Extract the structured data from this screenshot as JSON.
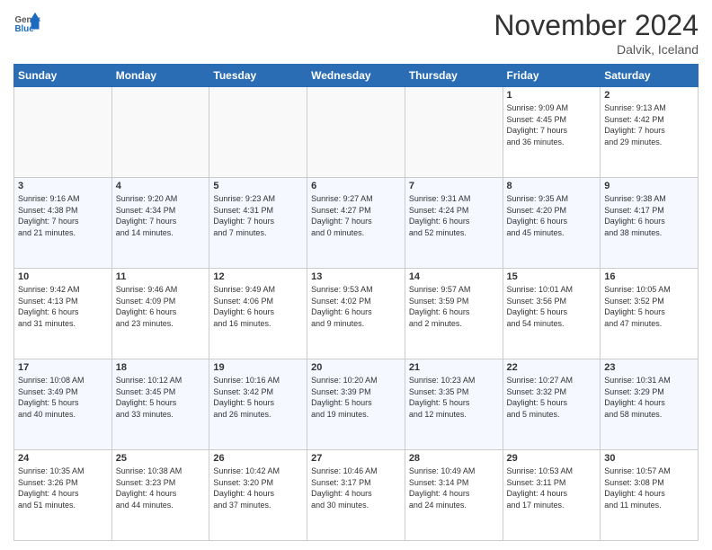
{
  "header": {
    "logo_general": "General",
    "logo_blue": "Blue",
    "month_title": "November 2024",
    "subtitle": "Dalvik, Iceland"
  },
  "days_of_week": [
    "Sunday",
    "Monday",
    "Tuesday",
    "Wednesday",
    "Thursday",
    "Friday",
    "Saturday"
  ],
  "weeks": [
    [
      {
        "day": "",
        "info": ""
      },
      {
        "day": "",
        "info": ""
      },
      {
        "day": "",
        "info": ""
      },
      {
        "day": "",
        "info": ""
      },
      {
        "day": "",
        "info": ""
      },
      {
        "day": "1",
        "info": "Sunrise: 9:09 AM\nSunset: 4:45 PM\nDaylight: 7 hours\nand 36 minutes."
      },
      {
        "day": "2",
        "info": "Sunrise: 9:13 AM\nSunset: 4:42 PM\nDaylight: 7 hours\nand 29 minutes."
      }
    ],
    [
      {
        "day": "3",
        "info": "Sunrise: 9:16 AM\nSunset: 4:38 PM\nDaylight: 7 hours\nand 21 minutes."
      },
      {
        "day": "4",
        "info": "Sunrise: 9:20 AM\nSunset: 4:34 PM\nDaylight: 7 hours\nand 14 minutes."
      },
      {
        "day": "5",
        "info": "Sunrise: 9:23 AM\nSunset: 4:31 PM\nDaylight: 7 hours\nand 7 minutes."
      },
      {
        "day": "6",
        "info": "Sunrise: 9:27 AM\nSunset: 4:27 PM\nDaylight: 7 hours\nand 0 minutes."
      },
      {
        "day": "7",
        "info": "Sunrise: 9:31 AM\nSunset: 4:24 PM\nDaylight: 6 hours\nand 52 minutes."
      },
      {
        "day": "8",
        "info": "Sunrise: 9:35 AM\nSunset: 4:20 PM\nDaylight: 6 hours\nand 45 minutes."
      },
      {
        "day": "9",
        "info": "Sunrise: 9:38 AM\nSunset: 4:17 PM\nDaylight: 6 hours\nand 38 minutes."
      }
    ],
    [
      {
        "day": "10",
        "info": "Sunrise: 9:42 AM\nSunset: 4:13 PM\nDaylight: 6 hours\nand 31 minutes."
      },
      {
        "day": "11",
        "info": "Sunrise: 9:46 AM\nSunset: 4:09 PM\nDaylight: 6 hours\nand 23 minutes."
      },
      {
        "day": "12",
        "info": "Sunrise: 9:49 AM\nSunset: 4:06 PM\nDaylight: 6 hours\nand 16 minutes."
      },
      {
        "day": "13",
        "info": "Sunrise: 9:53 AM\nSunset: 4:02 PM\nDaylight: 6 hours\nand 9 minutes."
      },
      {
        "day": "14",
        "info": "Sunrise: 9:57 AM\nSunset: 3:59 PM\nDaylight: 6 hours\nand 2 minutes."
      },
      {
        "day": "15",
        "info": "Sunrise: 10:01 AM\nSunset: 3:56 PM\nDaylight: 5 hours\nand 54 minutes."
      },
      {
        "day": "16",
        "info": "Sunrise: 10:05 AM\nSunset: 3:52 PM\nDaylight: 5 hours\nand 47 minutes."
      }
    ],
    [
      {
        "day": "17",
        "info": "Sunrise: 10:08 AM\nSunset: 3:49 PM\nDaylight: 5 hours\nand 40 minutes."
      },
      {
        "day": "18",
        "info": "Sunrise: 10:12 AM\nSunset: 3:45 PM\nDaylight: 5 hours\nand 33 minutes."
      },
      {
        "day": "19",
        "info": "Sunrise: 10:16 AM\nSunset: 3:42 PM\nDaylight: 5 hours\nand 26 minutes."
      },
      {
        "day": "20",
        "info": "Sunrise: 10:20 AM\nSunset: 3:39 PM\nDaylight: 5 hours\nand 19 minutes."
      },
      {
        "day": "21",
        "info": "Sunrise: 10:23 AM\nSunset: 3:35 PM\nDaylight: 5 hours\nand 12 minutes."
      },
      {
        "day": "22",
        "info": "Sunrise: 10:27 AM\nSunset: 3:32 PM\nDaylight: 5 hours\nand 5 minutes."
      },
      {
        "day": "23",
        "info": "Sunrise: 10:31 AM\nSunset: 3:29 PM\nDaylight: 4 hours\nand 58 minutes."
      }
    ],
    [
      {
        "day": "24",
        "info": "Sunrise: 10:35 AM\nSunset: 3:26 PM\nDaylight: 4 hours\nand 51 minutes."
      },
      {
        "day": "25",
        "info": "Sunrise: 10:38 AM\nSunset: 3:23 PM\nDaylight: 4 hours\nand 44 minutes."
      },
      {
        "day": "26",
        "info": "Sunrise: 10:42 AM\nSunset: 3:20 PM\nDaylight: 4 hours\nand 37 minutes."
      },
      {
        "day": "27",
        "info": "Sunrise: 10:46 AM\nSunset: 3:17 PM\nDaylight: 4 hours\nand 30 minutes."
      },
      {
        "day": "28",
        "info": "Sunrise: 10:49 AM\nSunset: 3:14 PM\nDaylight: 4 hours\nand 24 minutes."
      },
      {
        "day": "29",
        "info": "Sunrise: 10:53 AM\nSunset: 3:11 PM\nDaylight: 4 hours\nand 17 minutes."
      },
      {
        "day": "30",
        "info": "Sunrise: 10:57 AM\nSunset: 3:08 PM\nDaylight: 4 hours\nand 11 minutes."
      }
    ]
  ]
}
